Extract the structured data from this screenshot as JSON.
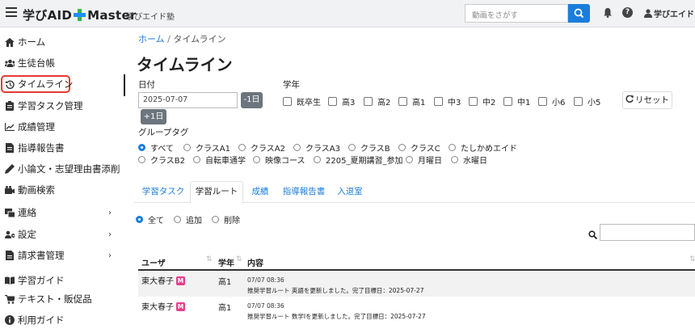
{
  "header": {
    "brand_prefix": "学びAID",
    "brand_suffix": "Master",
    "school": "学びエイド塾",
    "search_placeholder": "動画をさがす",
    "user": "学びエイド..."
  },
  "sidebar": {
    "items": [
      {
        "label": "ホーム",
        "icon": "home-icon"
      },
      {
        "label": "生徒台帳",
        "icon": "users-icon"
      },
      {
        "label": "タイムライン",
        "icon": "history-icon"
      },
      {
        "label": "学習タスク管理",
        "icon": "clipboard-icon"
      },
      {
        "label": "成績管理",
        "icon": "chart-line-icon"
      },
      {
        "label": "指導報告書",
        "icon": "document-icon"
      },
      {
        "label": "小論文・志望理由書添削",
        "icon": "pen-icon"
      },
      {
        "label": "動画検索",
        "icon": "video-icon"
      },
      {
        "label": "連絡",
        "icon": "message-icon"
      },
      {
        "label": "設定",
        "icon": "users-cog-icon"
      },
      {
        "label": "請求書管理",
        "icon": "invoice-icon"
      },
      {
        "label": "学習ガイド",
        "icon": "book-icon"
      },
      {
        "label": "テキスト・販促品",
        "icon": "cart-icon"
      },
      {
        "label": "利用ガイド",
        "icon": "info-icon"
      }
    ]
  },
  "breadcrumb": {
    "home": "ホーム",
    "separator": "/",
    "current": "タイムライン"
  },
  "page_title": "タイムライン",
  "filters": {
    "date_label": "日付",
    "date_value": "2025-07-07",
    "minus_day": "-1日",
    "plus_day": "+1日",
    "grade_label": "学年",
    "grades": [
      "既卒生",
      "高3",
      "高2",
      "高1",
      "中3",
      "中2",
      "中1",
      "小6",
      "小5"
    ],
    "reset_label": "リセット",
    "group_label": "グループタグ",
    "groups": [
      "すべて",
      "クラスA1",
      "クラスA2",
      "クラスA3",
      "クラスB",
      "クラスC",
      "たしかめエイド",
      "クラスB2",
      "自転車通学",
      "映像コース",
      "2205_夏期講習_参加",
      "月曜日",
      "水曜日"
    ],
    "group_selected": "すべて"
  },
  "tabs": [
    "学習タスク",
    "学習ルート",
    "成績",
    "指導報告書",
    "入退室"
  ],
  "active_tab": "学習ルート",
  "action_filter": {
    "options": [
      "全て",
      "追加",
      "削除"
    ],
    "selected": "全て"
  },
  "table": {
    "headers": [
      "ユーザ",
      "学年",
      "内容"
    ],
    "rows": [
      {
        "user": "東大春子",
        "badge": "M",
        "grade": "高1",
        "time": "07/07 08:36",
        "content": "推奨学習ルート 英語を更新しました。完了目標日：2025-07-27"
      },
      {
        "user": "東大春子",
        "badge": "M",
        "grade": "高1",
        "time": "07/07 08:36",
        "content": "推奨学習ルート 数学Ⅰを更新しました。完了目標日：2025-07-27"
      }
    ]
  },
  "colors": {
    "accent": "#1b7ddb",
    "highlight": "#e53935",
    "badge": "#e83e8c"
  }
}
